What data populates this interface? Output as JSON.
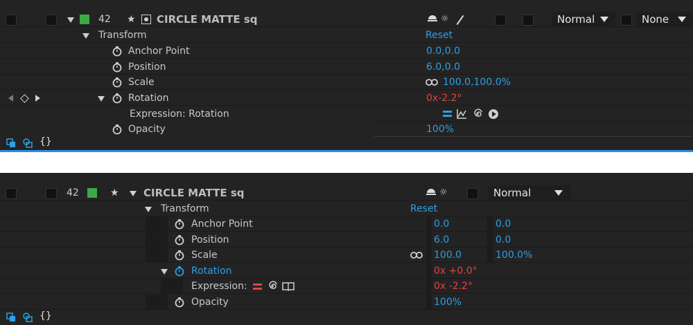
{
  "top": {
    "layer": {
      "number": "42",
      "name": "CIRCLE MATTE sq",
      "mode": "Normal",
      "trkmat": "None",
      "label_color": "#3aaa48"
    },
    "transform": {
      "label": "Transform",
      "reset": "Reset"
    },
    "properties": [
      {
        "name": "Anchor Point",
        "value": "0.0,0.0"
      },
      {
        "name": "Position",
        "value": "6.0,0.0"
      },
      {
        "name": "Scale",
        "value": "100.0,100.0%"
      },
      {
        "name": "Rotation",
        "value": "0x-2.2°"
      },
      {
        "name": "Expression: Rotation",
        "value": ""
      },
      {
        "name": "Opacity",
        "value": "100%"
      }
    ]
  },
  "bottom": {
    "layer": {
      "number": "42",
      "name": "CIRCLE MATTE sq",
      "mode": "Normal",
      "label_color": "#3aaa48"
    },
    "transform": {
      "label": "Transform",
      "reset": "Reset"
    },
    "properties": [
      {
        "name": "Anchor Point",
        "v1": "0.0",
        "v2": "0.0"
      },
      {
        "name": "Position",
        "v1": "6.0",
        "v2": "0.0"
      },
      {
        "name": "Scale",
        "v1": "100.0",
        "v2": "100.0%"
      },
      {
        "name": "Rotation",
        "v1": "0x +0.0°"
      },
      {
        "name": "Expression:",
        "v1": "0x -2.2°"
      },
      {
        "name": "Opacity",
        "v1": "100%"
      }
    ]
  },
  "colors": {
    "accent_blue": "#2d9fe5",
    "expression_red": "#e5443c",
    "panel_bg": "#232323",
    "selection_bar": "#2d8ceb"
  }
}
